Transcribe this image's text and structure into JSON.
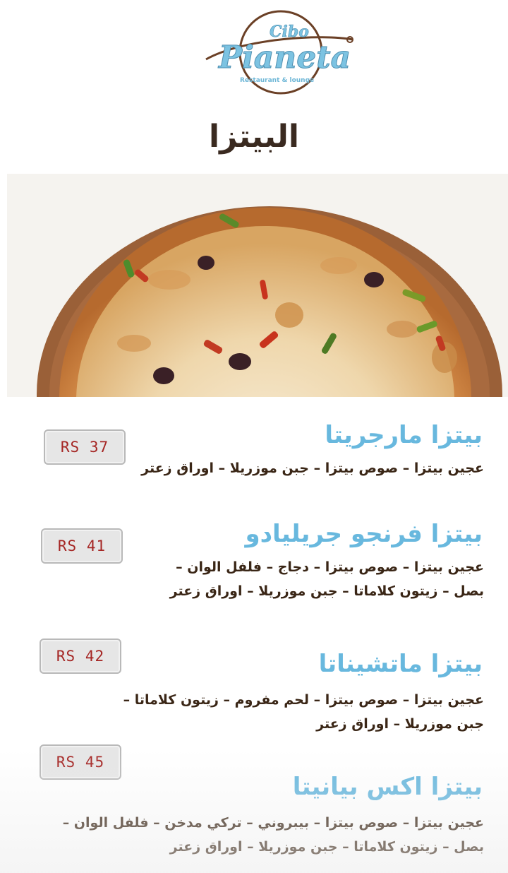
{
  "logo": {
    "top_word": "Cibo",
    "name": "Pianeta",
    "tagline": "Restaurant & lounge"
  },
  "page_title": "البيتزا",
  "hero_image": {
    "subject": "pizza-photo"
  },
  "menu_items": [
    {
      "name": "بيتزا مارجريتا",
      "price": "RS 37",
      "description_lines": [
        "عجين بيتزا – صوص بيتزا – جبن موزريلا – اوراق زعتر"
      ]
    },
    {
      "name": "بيتزا فرنجو جريليادو",
      "price": "RS 41",
      "description_lines": [
        "عجين بيتزا – صوص بيتزا – دجاج – فلفل الوان –",
        "بصل – زيتون كلاماتا – جبن موزريلا – اوراق زعتر"
      ]
    },
    {
      "name": "بيتزا ماتشيناتا",
      "price": "RS 42",
      "description_lines": [
        "عجين بيتزا – صوص بيتزا – لحم مفروم  – زيتون كلاماتا –",
        "جبن موزريلا – اوراق زعتر"
      ]
    },
    {
      "name": "بيتزا اكس بيانيتا",
      "price": "RS 45",
      "description_lines": [
        "عجين بيتزا – صوص بيتزا – بيبروني – تركي مدخن – فلفل الوان  –",
        "بصل – زيتون كلاماتا – جبن موزريلا – اوراق زعتر"
      ]
    }
  ],
  "colors": {
    "title": "#3a2a20",
    "item_name": "#68b8de",
    "description": "#3a2616",
    "price_text": "#a52624",
    "logo_brown": "#6b4026",
    "logo_blue": "#7cc3e2"
  }
}
